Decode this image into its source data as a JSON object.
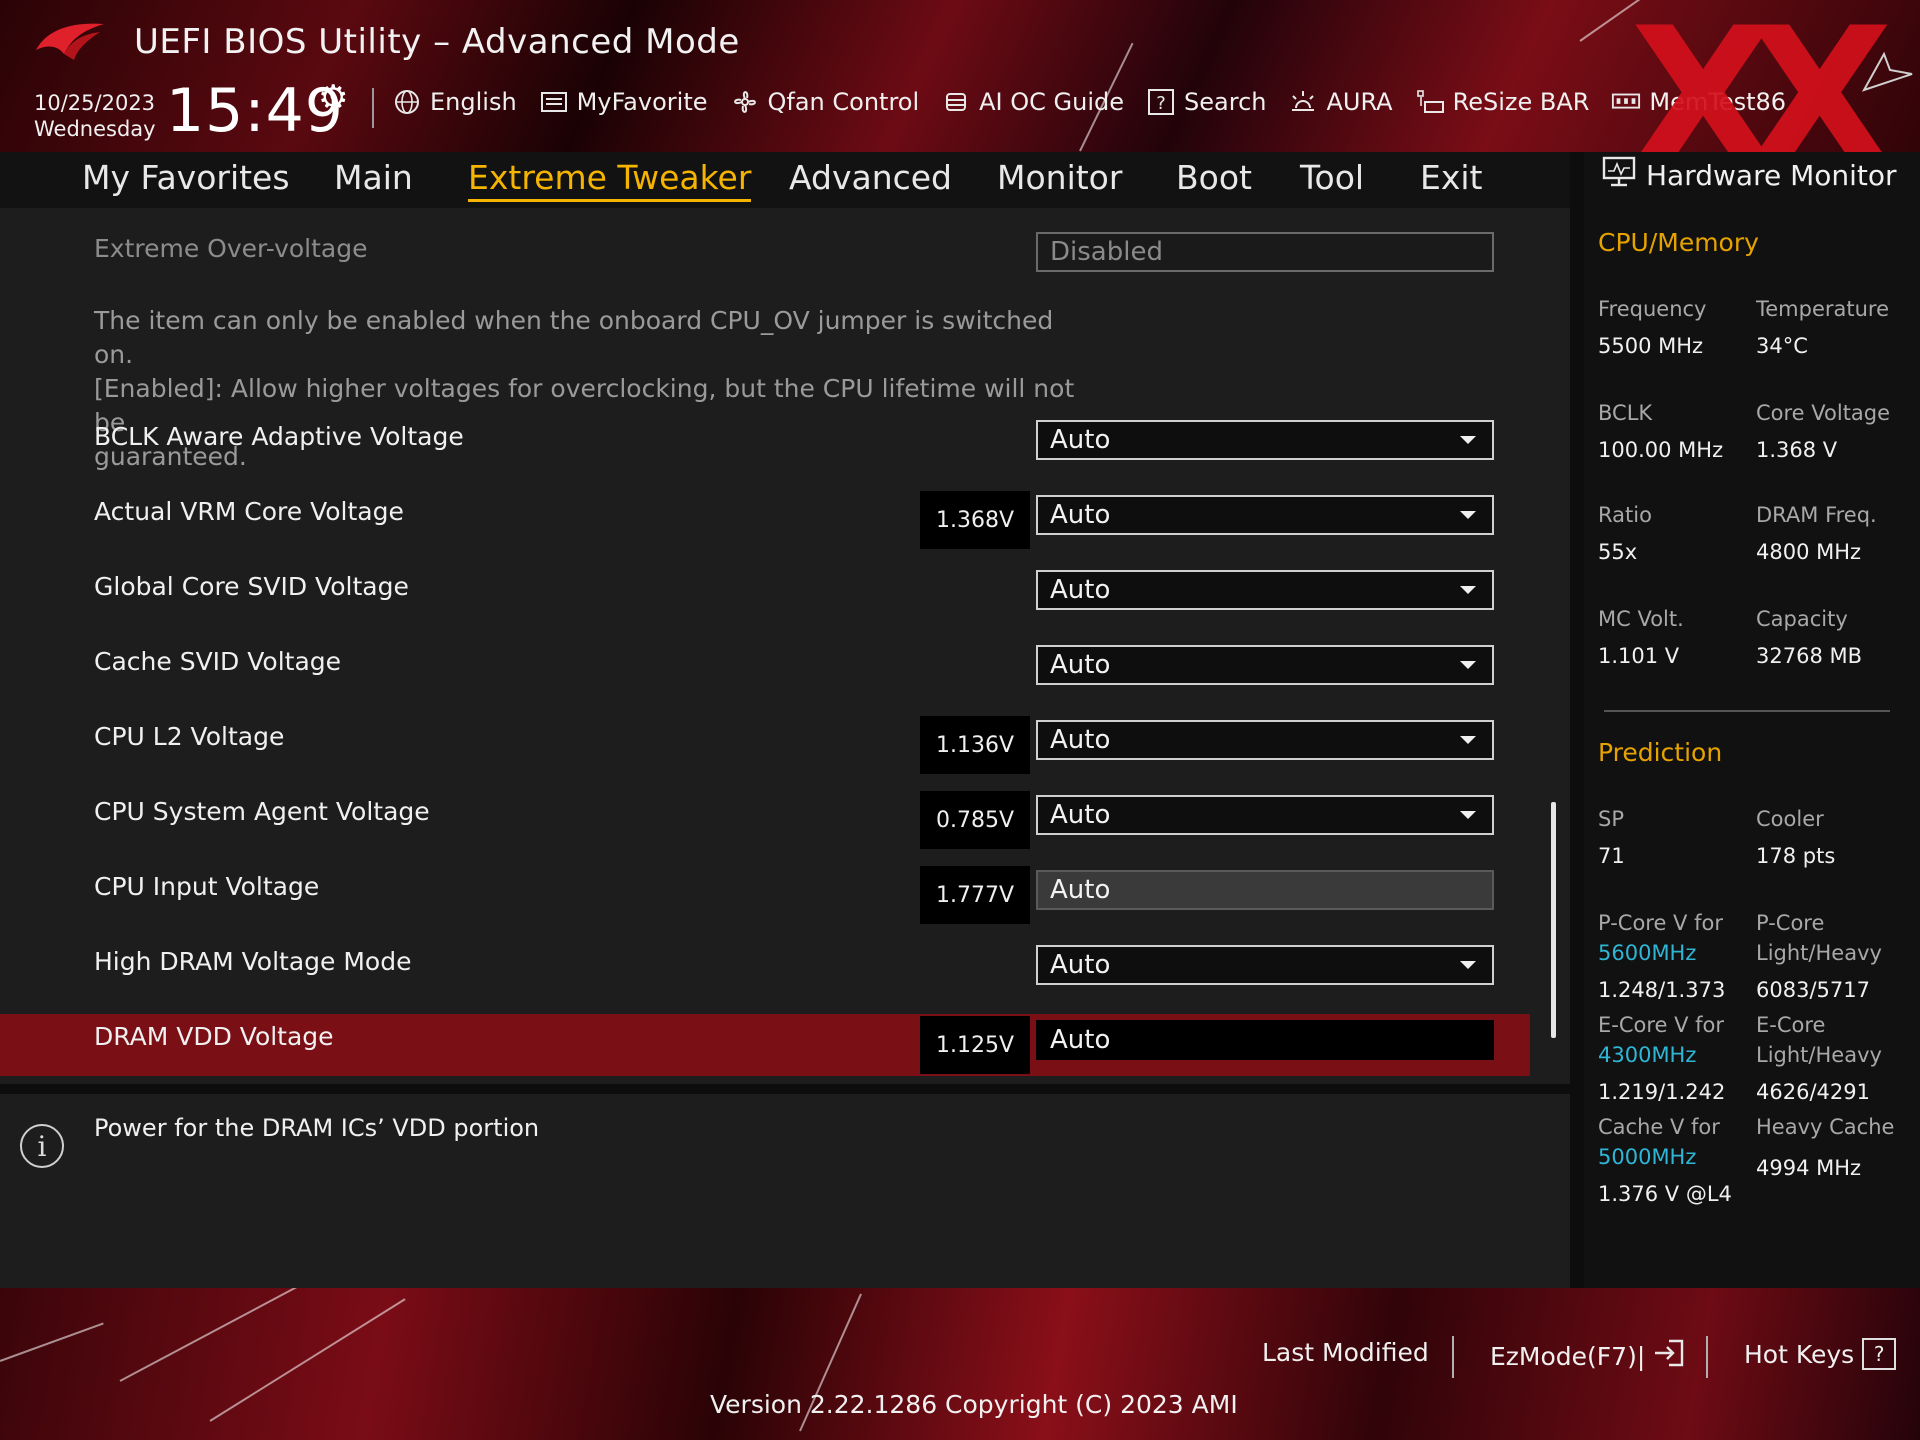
{
  "header": {
    "title": "UEFI BIOS Utility – Advanced Mode",
    "date": "10/25/2023",
    "weekday": "Wednesday",
    "time": "15:49",
    "toolbar": [
      {
        "label": "English",
        "icon": "globe-icon"
      },
      {
        "label": "MyFavorite",
        "icon": "favorite-list-icon"
      },
      {
        "label": "Qfan Control",
        "icon": "fan-icon"
      },
      {
        "label": "AI OC Guide",
        "icon": "ai-chip-icon"
      },
      {
        "label": "Search",
        "icon": "help-box-icon"
      },
      {
        "label": "AURA",
        "icon": "aura-light-icon"
      },
      {
        "label": "ReSize BAR",
        "icon": "resize-bar-icon"
      },
      {
        "label": "MemTest86",
        "icon": "memory-icon"
      }
    ],
    "watermark": "XX"
  },
  "tabs": [
    "My Favorites",
    "Main",
    "Extreme Tweaker",
    "Advanced",
    "Monitor",
    "Boot",
    "Tool",
    "Exit"
  ],
  "active_tab": "Extreme Tweaker",
  "settings": {
    "extreme_overvoltage": {
      "label": "Extreme Over-voltage",
      "value": "Disabled"
    },
    "description": [
      "The item can only be enabled when the onboard CPU_OV jumper is switched on.",
      "[Enabled]: Allow higher voltages for overclocking, but the CPU lifetime will not be",
      "guaranteed."
    ],
    "rows": [
      {
        "label": "BCLK Aware Adaptive Voltage",
        "reading": "",
        "value": "Auto"
      },
      {
        "label": "Actual VRM Core Voltage",
        "reading": "1.368V",
        "value": "Auto"
      },
      {
        "label": "Global Core SVID Voltage",
        "reading": "",
        "value": "Auto"
      },
      {
        "label": "Cache SVID Voltage",
        "reading": "",
        "value": "Auto"
      },
      {
        "label": "CPU L2 Voltage",
        "reading": "1.136V",
        "value": "Auto"
      },
      {
        "label": "CPU System Agent Voltage",
        "reading": "0.785V",
        "value": "Auto"
      },
      {
        "label": "CPU Input Voltage",
        "reading": "1.777V",
        "value": "Auto"
      },
      {
        "label": "High DRAM Voltage Mode",
        "reading": "",
        "value": "Auto"
      },
      {
        "label": "DRAM VDD Voltage",
        "reading": "1.125V",
        "value": "Auto"
      }
    ]
  },
  "help": {
    "text": "Power for the DRAM ICs’ VDD portion"
  },
  "hardware_monitor": {
    "title": "Hardware Monitor",
    "cpu_memory": {
      "title": "CPU/Memory",
      "frequency_label": "Frequency",
      "frequency": "5500 MHz",
      "temperature_label": "Temperature",
      "temperature": "34°C",
      "bclk_label": "BCLK",
      "bclk": "100.00 MHz",
      "core_voltage_label": "Core Voltage",
      "core_voltage": "1.368 V",
      "ratio_label": "Ratio",
      "ratio": "55x",
      "dram_freq_label": "DRAM Freq.",
      "dram_freq": "4800 MHz",
      "mc_volt_label": "MC Volt.",
      "mc_volt": "1.101 V",
      "capacity_label": "Capacity",
      "capacity": "32768 MB"
    },
    "prediction": {
      "title": "Prediction",
      "sp_label": "SP",
      "sp": "71",
      "cooler_label": "Cooler",
      "cooler": "178 pts",
      "pcore_v_label": "P-Core V for",
      "pcore_v_freq": "5600MHz",
      "pcore_v": "1.248/1.373",
      "pcore_lh_label1": "P-Core",
      "pcore_lh_label2": "Light/Heavy",
      "pcore_lh": "6083/5717",
      "ecore_v_label": "E-Core V for",
      "ecore_v_freq": "4300MHz",
      "ecore_v": "1.219/1.242",
      "ecore_lh_label1": "E-Core",
      "ecore_lh_label2": "Light/Heavy",
      "ecore_lh": "4626/4291",
      "cache_v_label": "Cache V for",
      "cache_v_freq": "5000MHz",
      "cache_v": "1.376 V @L4",
      "heavy_cache_label": "Heavy Cache",
      "heavy_cache": "4994 MHz"
    }
  },
  "footer": {
    "last_modified": "Last Modified",
    "ezmode": "EzMode(F7)|",
    "hotkeys": "Hot Keys",
    "version": "Version 2.22.1286 Copyright (C) 2023 AMI"
  },
  "colors": {
    "accent": "#f5b400",
    "highlight_row": "#7a0f16",
    "prediction_freq": "#2fb6d6",
    "watermark": "#d3101c"
  }
}
